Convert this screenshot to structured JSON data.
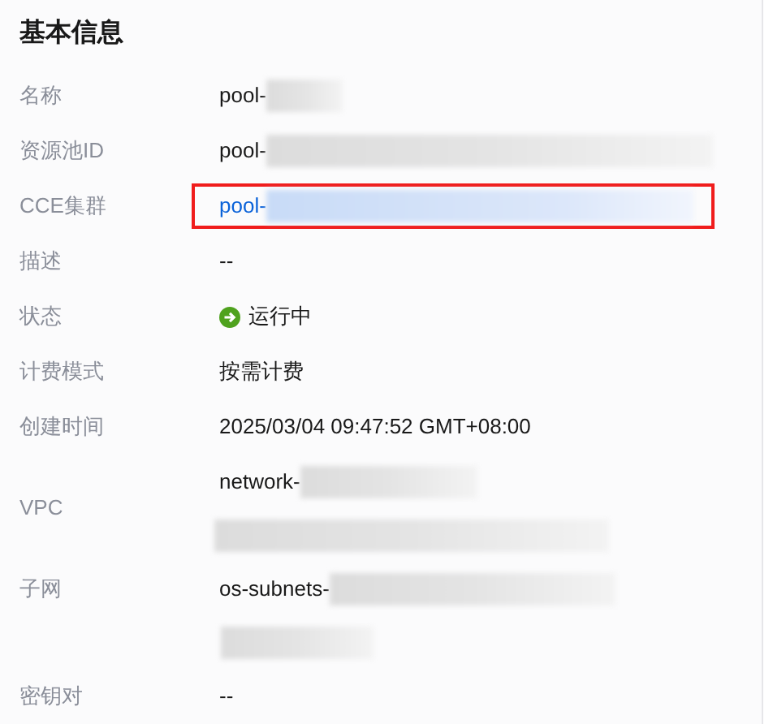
{
  "section": {
    "title": "基本信息"
  },
  "rows": [
    {
      "kind": "plain",
      "label": "名称",
      "lines": [
        {
          "text": "pool-",
          "redacted": true
        }
      ]
    },
    {
      "kind": "plain",
      "label": "资源池ID",
      "lines": [
        {
          "text": "pool-",
          "redacted": true
        }
      ]
    },
    {
      "kind": "plain",
      "label": "CCE集群",
      "link": true,
      "highlighted": true,
      "lines": [
        {
          "text": "pool-",
          "redacted": true
        }
      ]
    },
    {
      "kind": "plain",
      "label": "描述",
      "lines": [
        {
          "text": "--",
          "redacted": false
        }
      ]
    },
    {
      "kind": "status",
      "label": "状态",
      "lines": [
        {
          "text": "运行中",
          "redacted": false
        }
      ]
    },
    {
      "kind": "plain",
      "label": "计费模式",
      "lines": [
        {
          "text": "按需计费",
          "redacted": false
        }
      ]
    },
    {
      "kind": "plain",
      "label": "创建时间",
      "lines": [
        {
          "text": "2025/03/04 09:47:52 GMT+08:00",
          "redacted": false
        }
      ]
    },
    {
      "kind": "centered",
      "label": "VPC",
      "lines": [
        {
          "text": "network-",
          "redacted": true
        },
        {
          "redacted": true
        }
      ]
    },
    {
      "kind": "top",
      "label": "子网",
      "lines": [
        {
          "text": "os-subnets-",
          "redacted": true
        },
        {
          "redacted": true
        }
      ]
    },
    {
      "kind": "plain",
      "label": "密钥对",
      "lines": [
        {
          "text": "--",
          "redacted": false
        }
      ]
    }
  ]
}
